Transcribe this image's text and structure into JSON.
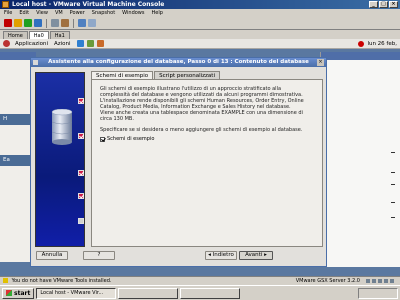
{
  "vmware": {
    "title": "Local host - VMware Virtual Machine Console",
    "menu": [
      "File",
      "Edit",
      "View",
      "VM",
      "Power",
      "Snapshot",
      "Windows",
      "Help"
    ],
    "tabs": [
      {
        "label": "Home",
        "active": false
      },
      {
        "label": "Ha0",
        "active": true
      },
      {
        "label": "Ha1",
        "active": false
      }
    ],
    "status_message": "You do not have VMware Tools installed.",
    "status_version": "VMware GSX Server 3.2.0"
  },
  "guest": {
    "panel": {
      "applications": "Applicazioni",
      "actions": "Azioni",
      "clock": "lun 26 feb,"
    },
    "left_window_rows": [
      "H",
      "Ea"
    ]
  },
  "dialog": {
    "title": "Assistente alla configurazione del database, Passo 0 di 13 : Contenuto del database",
    "tabs": [
      "Schemi di esempio",
      "Script personalizzati"
    ],
    "active_tab": "Schemi di esempio",
    "paragraph1": "Gli schemi di esempio illustrano l'utilizzo di un approccio stratificato alla complessità del database e vengono utilizzati da alcuni programmi dimostrativa. L'installazione rende disponibili gli schemi Human Resources, Order Entry, Online Catalog, Product Media, Information Exchange e Sales History nel database. Viene anche creata una tablespace denominata EXAMPLE con una dimensione di circa 130 MB.",
    "paragraph2": "Specificare se si desidera o meno aggiungere gli schemi di esempio al database.",
    "checkbox_label": "Schemi di esempio",
    "checkbox_checked": true,
    "buttons": {
      "cancel": "Annulla",
      "help": "?",
      "back": "Indietro",
      "next": "Avanti"
    }
  },
  "taskbar": {
    "start": "start",
    "items": [
      "Local host - VMware Vir...",
      "",
      ""
    ],
    "clock": ""
  },
  "colors": {
    "accent": "#4a6ea8",
    "side_panel": "#0a1a7a",
    "step_done": "#cc1b4a"
  }
}
